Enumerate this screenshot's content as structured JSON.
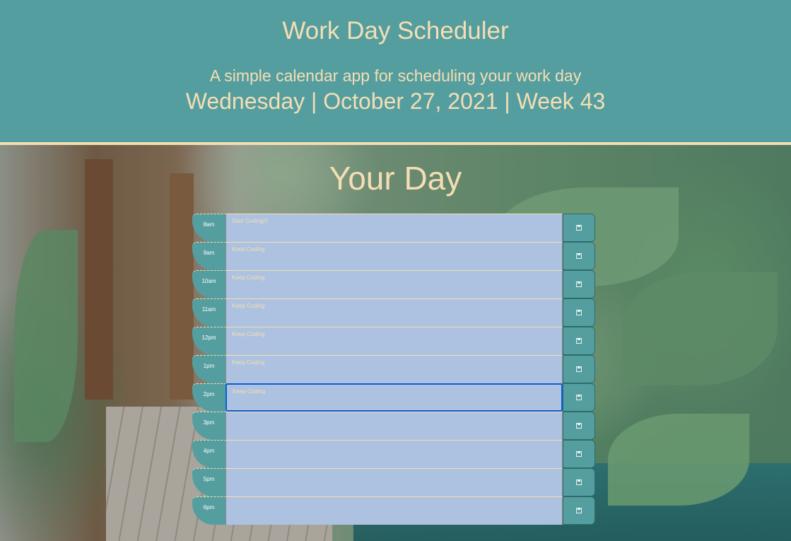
{
  "header": {
    "title": "Work Day Scheduler",
    "lead": "A simple calendar app for scheduling your work day",
    "current_date": "Wednesday | October 27, 2021 | Week 43"
  },
  "main": {
    "heading": "Your Day"
  },
  "colors": {
    "header_bg": "#559ea0",
    "accent_text": "#f5deb3",
    "task_bg": "#adc2e0",
    "focus_border": "#0b5ed7"
  },
  "rows": [
    {
      "hour": "8am",
      "task": "Start Coding!!!"
    },
    {
      "hour": "9am",
      "task": "Keep Coding"
    },
    {
      "hour": "10am",
      "task": "Keep Coding"
    },
    {
      "hour": "11am",
      "task": "Keep Coding"
    },
    {
      "hour": "12pm",
      "task": "Keep Coding"
    },
    {
      "hour": "1pm",
      "task": "Keep Coding"
    },
    {
      "hour": "2pm",
      "task": "Keep Coding",
      "focused": true
    },
    {
      "hour": "3pm",
      "task": ""
    },
    {
      "hour": "4pm",
      "task": ""
    },
    {
      "hour": "5pm",
      "task": ""
    },
    {
      "hour": "6pm",
      "task": ""
    }
  ],
  "save_icon": "save-icon"
}
